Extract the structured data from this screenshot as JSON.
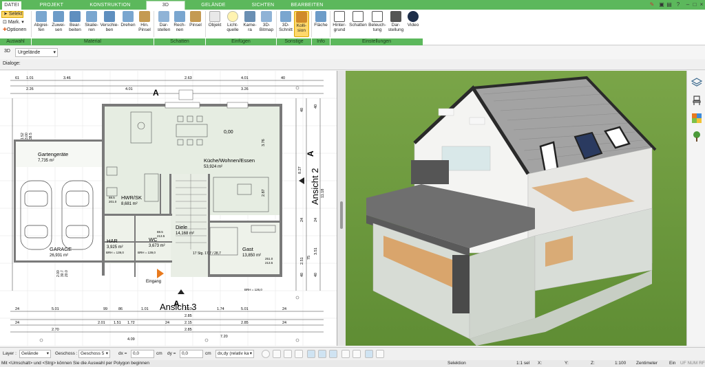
{
  "tabs": [
    "DATEI",
    "PROJEKT",
    "KONSTRUKTION",
    "3D",
    "GELÄNDE",
    "SICHTEN",
    "BEARBEITEN"
  ],
  "ribbon": {
    "auswahl": [
      "Selekt",
      "Mark.",
      "Optionen"
    ],
    "material": [
      "Abgrei-\nfen",
      "Zuwei-\nsen",
      "Bear-\nbeiten",
      "Skalie-\nren",
      "Verschie-\nben",
      "Drehen",
      "Hin.\nPinsel"
    ],
    "schatten": [
      "Dar-\nstellen",
      "Rech-\nnen",
      "Pinsel"
    ],
    "einfuegen": [
      "Objekt",
      "Licht-\nquelle",
      "Kame-\nra",
      "3D-\nBitmap"
    ],
    "sonstige": [
      "3D-\nSchnitt",
      "Kolli-\nsion"
    ],
    "info": [
      "Fläche"
    ],
    "einstellungen": [
      "Hinter-\ngrund",
      "Schatten",
      "Beleuch-\ntung",
      "Dar-\nstellung",
      "Video"
    ],
    "groups": [
      "Auswahl",
      "Material",
      "Schatten",
      "Einfügen",
      "Sonstige",
      "Info",
      "Einstellungen"
    ]
  },
  "toolbar": {
    "view_mode": "3D",
    "terrain": "Urgelände",
    "dialoge": "Dialoge:"
  },
  "plan": {
    "rooms": [
      {
        "name": "Gartengeräte",
        "area": "7,735 m²"
      },
      {
        "name": "Küche/Wohnen/Essen",
        "area": "53,924 m²"
      },
      {
        "name": "HWR/SK",
        "area": "8,681 m²"
      },
      {
        "name": "HAR",
        "area": "3,925 m²"
      },
      {
        "name": "WC",
        "area": "3,673 m²"
      },
      {
        "name": "Diele",
        "area": "14,168 m²"
      },
      {
        "name": "Gast",
        "area": "13,850 m²"
      },
      {
        "name": "GARAGE",
        "area": "26,931 m²"
      }
    ],
    "level": "0,00",
    "entrance": "Eingang",
    "stairs": "17 Stg.\n17,7 / 28,7",
    "brh": [
      "BRH = 139,0",
      "BRH = 139,0",
      "BRH = 126,0"
    ],
    "section_marks": [
      "A",
      "A",
      "A"
    ],
    "view_labels": [
      "Ansicht 2",
      "Ansicht 3"
    ],
    "top_dims_row1": [
      "61",
      "1.01",
      "3.46",
      "2.63",
      "4.01",
      "40"
    ],
    "top_dims_row2": [
      "2.26",
      "4.01",
      "3.26"
    ],
    "bottom_dims_row1": [
      "24",
      "5.01",
      "99",
      "86",
      "1.01",
      "2.13",
      "1.74",
      "5.01",
      "24"
    ],
    "bottom_dims_row2": [
      "2.85",
      "2.85"
    ],
    "bottom_dims_row3": [
      "24",
      "2.01",
      "1.51",
      "1.72",
      "24",
      "2.15",
      "2.85",
      "24"
    ],
    "bottom_dims_row4": [
      "2.70",
      "7.20"
    ],
    "bottom_dims_row5": [
      "4.09"
    ],
    "right_dims": [
      "8.27",
      "11.18",
      "3.76",
      "2.87",
      "3.51",
      "75",
      "2.51",
      "40",
      "24",
      "40",
      "40",
      "24",
      "40"
    ],
    "left_dims": [
      "1.52",
      "3.00",
      "38.5",
      "2.00",
      "30.7",
      "20.0",
      "88.5",
      "201.0",
      "88.5",
      "213.5",
      "251.0",
      "213.5"
    ]
  },
  "layerbar": {
    "layer_label": "Layer :",
    "layer_value": "Gelände",
    "geschoss_label": "Geschoss :",
    "geschoss_value": "Geschoss 5",
    "dx_label": "dx =",
    "dx_value": "0,0",
    "dx_unit": "cm",
    "dy_label": "dy =",
    "dy_value": "0,0",
    "dy_unit": "cm",
    "mode_value": "dx,dy (relativ ka"
  },
  "statusbar": {
    "hint": "Mit <Umschalt> und <Strg> können Sie die Auswahl per Polygon beginnen",
    "mode": "Selektion",
    "selection": "1:1 sel",
    "x": "X:",
    "y": "Y:",
    "z": "Z:",
    "scale": "1:100",
    "unit": "Zentimeter",
    "ein": "Ein",
    "flags": "UF NUM RF"
  },
  "colors": {
    "accent": "#5cb85c",
    "grass": "#6b9a3a",
    "roof": "#9a9a9a",
    "floor": "#d9a56c"
  }
}
